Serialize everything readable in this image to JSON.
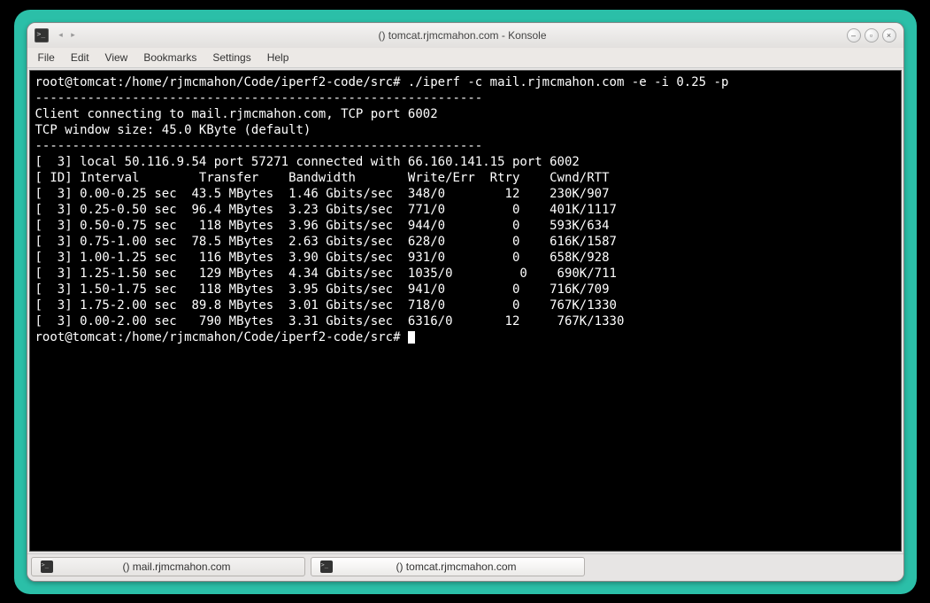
{
  "window": {
    "title": "() tomcat.rjmcmahon.com - Konsole"
  },
  "menu": {
    "file": "File",
    "edit": "Edit",
    "view": "View",
    "bookmarks": "Bookmarks",
    "settings": "Settings",
    "help": "Help"
  },
  "terminal": {
    "prompt1": "root@tomcat:/home/rjmcmahon/Code/iperf2-code/src# ./iperf -c mail.rjmcmahon.com -e -i 0.25 -p",
    "dashes1": "------------------------------------------------------------",
    "line_connect": "Client connecting to mail.rjmcmahon.com, TCP port 6002",
    "line_window": "TCP window size: 45.0 KByte (default)",
    "dashes2": "------------------------------------------------------------",
    "line_local": "[  3] local 50.116.9.54 port 57271 connected with 66.160.141.15 port 6002",
    "header": "[ ID] Interval        Transfer    Bandwidth       Write/Err  Rtry    Cwnd/RTT",
    "rows": [
      "[  3] 0.00-0.25 sec  43.5 MBytes  1.46 Gbits/sec  348/0        12    230K/907",
      "[  3] 0.25-0.50 sec  96.4 MBytes  3.23 Gbits/sec  771/0         0    401K/1117",
      "[  3] 0.50-0.75 sec   118 MBytes  3.96 Gbits/sec  944/0         0    593K/634",
      "[  3] 0.75-1.00 sec  78.5 MBytes  2.63 Gbits/sec  628/0         0    616K/1587",
      "[  3] 1.00-1.25 sec   116 MBytes  3.90 Gbits/sec  931/0         0    658K/928",
      "[  3] 1.25-1.50 sec   129 MBytes  4.34 Gbits/sec  1035/0         0    690K/711",
      "[  3] 1.50-1.75 sec   118 MBytes  3.95 Gbits/sec  941/0         0    716K/709",
      "[  3] 1.75-2.00 sec  89.8 MBytes  3.01 Gbits/sec  718/0         0    767K/1330",
      "[  3] 0.00-2.00 sec   790 MBytes  3.31 Gbits/sec  6316/0       12     767K/1330"
    ],
    "prompt2": "root@tomcat:/home/rjmcmahon/Code/iperf2-code/src# "
  },
  "tabs": {
    "tab1": "() mail.rjmcmahon.com",
    "tab2": "() tomcat.rjmcmahon.com"
  }
}
